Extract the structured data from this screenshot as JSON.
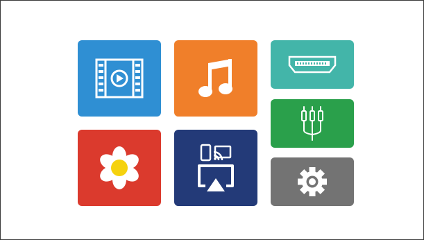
{
  "colors": {
    "background": "#ffffff",
    "border": "#3a3a3a",
    "video": "#2f8fd3",
    "music": "#f07f2a",
    "hdmi": "#43b5a9",
    "av": "#2aa04b",
    "photo": "#db3a2d",
    "mirror": "#233a78",
    "settings": "#737373",
    "flower_center": "#f5d20e",
    "icon": "#ffffff"
  },
  "tiles": [
    {
      "id": "video",
      "icon": "film-play-icon"
    },
    {
      "id": "music",
      "icon": "music-note-icon"
    },
    {
      "id": "hdmi",
      "icon": "hdmi-port-icon"
    },
    {
      "id": "av",
      "icon": "rca-cable-icon"
    },
    {
      "id": "photo",
      "icon": "flower-icon"
    },
    {
      "id": "mirror",
      "icon": "screen-mirror-icon"
    },
    {
      "id": "settings",
      "icon": "gear-icon"
    }
  ]
}
